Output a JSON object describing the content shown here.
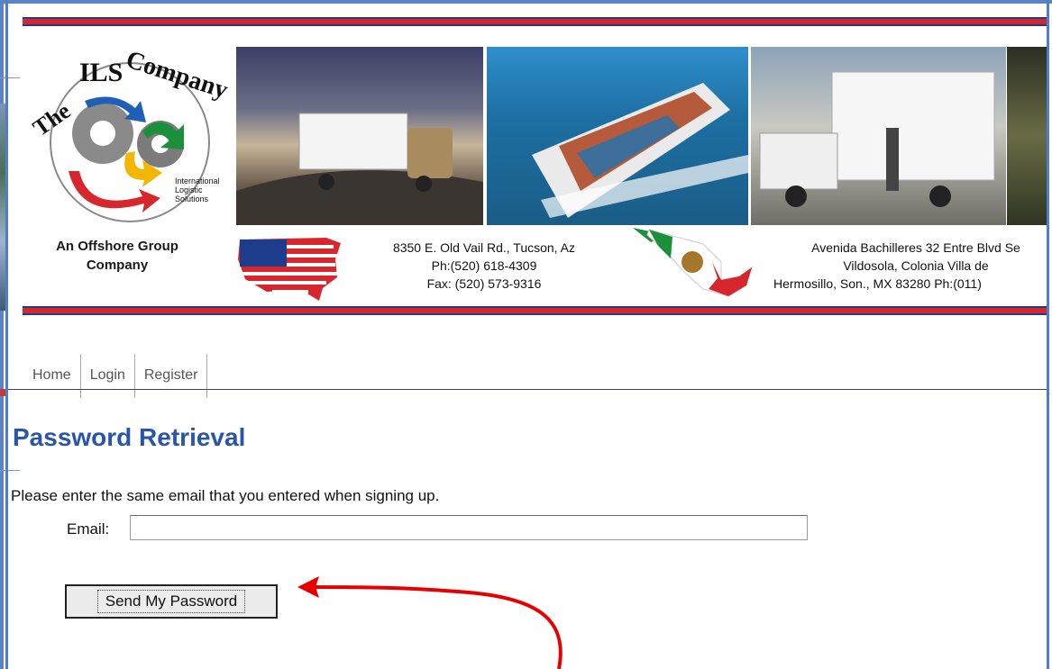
{
  "header": {
    "tagline_line1": "An Offshore Group",
    "tagline_line2": "Company",
    "logo_text": "The ILS Company",
    "logo_sub1": "International",
    "logo_sub2": "Logistic",
    "logo_sub3": "Solutions",
    "us_address": {
      "line1": "8350 E. Old Vail Rd.,  Tucson, Az",
      "line2": "Ph:(520) 618-4309",
      "line3": "Fax: (520) 573-9316"
    },
    "mx_address": {
      "line1": "Avenida Bachilleres 32 Entre Blvd Se",
      "line2": "Vildosola,  Colonia Villa de",
      "line3": "Hermosillo, Son., MX 83280   Ph:(011)"
    }
  },
  "nav": {
    "items": [
      "Home",
      "Login",
      "Register"
    ]
  },
  "page": {
    "title": "Password Retrieval",
    "instructions": "Please enter the same email that you entered when signing up.",
    "email_label": "Email:",
    "email_value": "",
    "send_button": "Send My Password"
  },
  "colors": {
    "title": "#2a56a8",
    "rule_red": "#d7262e",
    "rule_blue": "#1d3c8c",
    "annotation_red": "#e60000",
    "frame_blue": "#4f7fc8"
  }
}
